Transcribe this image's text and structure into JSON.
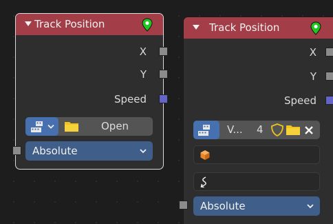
{
  "nodes": [
    {
      "title": "Track Position",
      "outputs": [
        {
          "label": "X",
          "socket": "gray"
        },
        {
          "label": "Y",
          "socket": "gray"
        },
        {
          "label": "Speed",
          "socket": "blue"
        }
      ],
      "clip_open_label": "Open",
      "mode_value": "Absolute"
    },
    {
      "title": "Track Position",
      "outputs": [
        {
          "label": "X",
          "socket": "gray"
        },
        {
          "label": "Y",
          "socket": "gray"
        },
        {
          "label": "Speed",
          "socket": "blue"
        }
      ],
      "clip_name": "V...",
      "clip_users": "4",
      "mode_value": "Absolute"
    }
  ],
  "colors": {
    "header": "#a33e48",
    "accent_blue": "#4670b0",
    "select_blue": "#3f5e8a",
    "socket_gray": "#8b8b8b",
    "socket_blue": "#6464c8"
  }
}
